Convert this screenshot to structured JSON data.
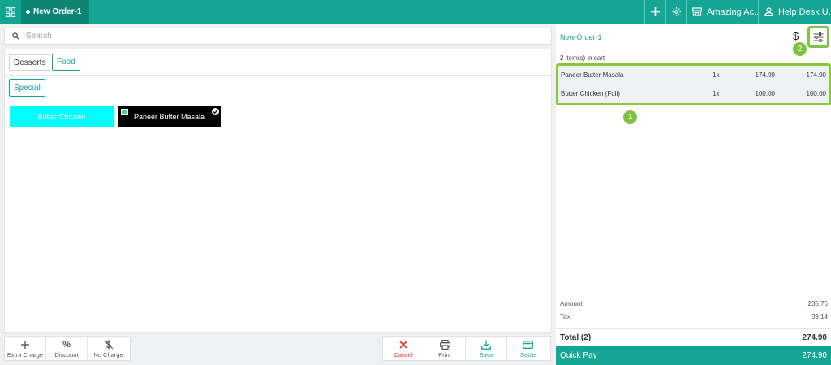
{
  "topbar": {
    "order_tab": "New Order-1",
    "account_label": "Amazing Ac...",
    "helpdesk_label": "Help Desk U..."
  },
  "search": {
    "placeholder": "Search"
  },
  "categories": [
    "Desserts",
    "Food"
  ],
  "subcategories": [
    "Special"
  ],
  "items": [
    {
      "name": "Butter Chicken",
      "color": "#00ffff"
    },
    {
      "name": "Paneer Butter Masala",
      "color": "#000000"
    }
  ],
  "actions_left": [
    {
      "label": "Extra Charge",
      "icon": "plus-icon"
    },
    {
      "label": "Discount",
      "icon": "percent-icon"
    },
    {
      "label": "No Charge",
      "icon": "no-dollar-icon"
    }
  ],
  "actions_right": [
    {
      "label": "Cancel",
      "icon": "close-icon",
      "color": "#dd3333"
    },
    {
      "label": "Print",
      "icon": "printer-icon"
    },
    {
      "label": "Save",
      "icon": "download-icon",
      "color": "#14a594"
    },
    {
      "label": "Settle",
      "icon": "card-icon",
      "color": "#14a594"
    }
  ],
  "order": {
    "title": "New Order-1",
    "currency_symbol": "$",
    "cart_count": "2 item(s) in cart",
    "lines": [
      {
        "name": "Paneer Butter Masala",
        "qty": "1x",
        "price": "174.90",
        "total": "174.90"
      },
      {
        "name": "Butter Chicken (Full)",
        "qty": "1x",
        "price": "100.00",
        "total": "100.00"
      }
    ],
    "amount_label": "Amount",
    "amount_value": "235.76",
    "tax_label": "Tax",
    "tax_value": "39.14",
    "total_label": "Total  (2)",
    "total_value": "274.90",
    "quickpay_label": "Quick Pay",
    "quickpay_value": "274.90"
  },
  "annotations": {
    "badge1": "1",
    "badge2": "2"
  },
  "colors": {
    "brand": "#14a594",
    "brand_dark": "#0c8575",
    "highlight": "#8cc63f",
    "danger": "#dd3333"
  }
}
